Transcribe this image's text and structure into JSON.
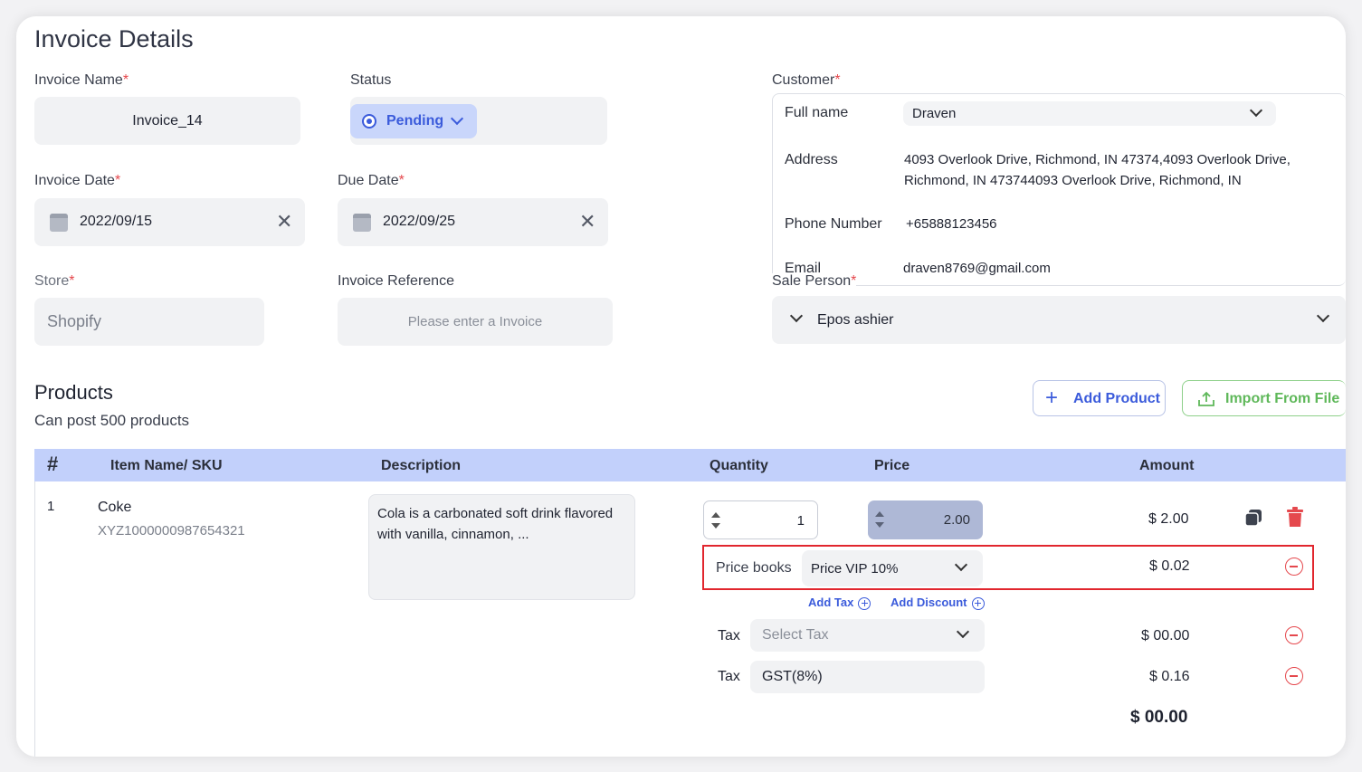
{
  "page": {
    "title": "Invoice Details"
  },
  "invoice_name": {
    "label": "Invoice Name",
    "value": "Invoice_14"
  },
  "status": {
    "label": "Status",
    "value": "Pending"
  },
  "invoice_date": {
    "label": "Invoice Date",
    "value": "2022/09/15"
  },
  "due_date": {
    "label": "Due Date",
    "value": "2022/09/25"
  },
  "store": {
    "label": "Store",
    "placeholder": "Shopify"
  },
  "invoice_reference": {
    "label": "Invoice Reference",
    "placeholder": "Please enter a Invoice"
  },
  "customer": {
    "label": "Customer",
    "full_name_label": "Full name",
    "full_name": "Draven",
    "address_label": "Address",
    "address_line1": "4093 Overlook Drive, Richmond, IN 47374,4093 Overlook Drive,",
    "address_line2": "Richmond, IN 473744093 Overlook Drive, Richmond, IN",
    "phone_label": "Phone Number",
    "phone": "+65888123456",
    "email_label": "Email",
    "email": "draven8769@gmail.com"
  },
  "sale_person": {
    "label": "Sale Person",
    "value": "Epos ashier"
  },
  "products": {
    "title": "Products",
    "subtitle": "Can post 500 products",
    "add_button": "Add Product",
    "import_button": "Import From File",
    "columns": [
      "#",
      "Item Name/ SKU",
      "Description",
      "Quantity",
      "Price",
      "Amount"
    ],
    "row": {
      "index": "1",
      "name": "Coke",
      "sku": "XYZ1000000987654321",
      "description_line1": "Cola is a carbonated soft drink flavored",
      "description_line2": "with vanilla, cinnamon, ...",
      "quantity": "1",
      "price": "2.00",
      "amount": "$ 2.00"
    },
    "price_books": {
      "label": "Price books",
      "value": "Price VIP 10%",
      "amount": "$ 0.02"
    },
    "add_tax": "Add Tax",
    "add_discount": "Add Discount",
    "taxes": [
      {
        "label": "Tax",
        "value": "Select Tax",
        "amount": "$ 00.00"
      },
      {
        "label": "Tax",
        "value": "GST(8%)",
        "amount": "$ 0.16"
      }
    ],
    "total": "$ 00.00"
  },
  "colors": {
    "accent": "#3b5bdb",
    "import_green": "#5fb85a",
    "danger": "#e5484d",
    "table_header": "#c2d0fb"
  }
}
